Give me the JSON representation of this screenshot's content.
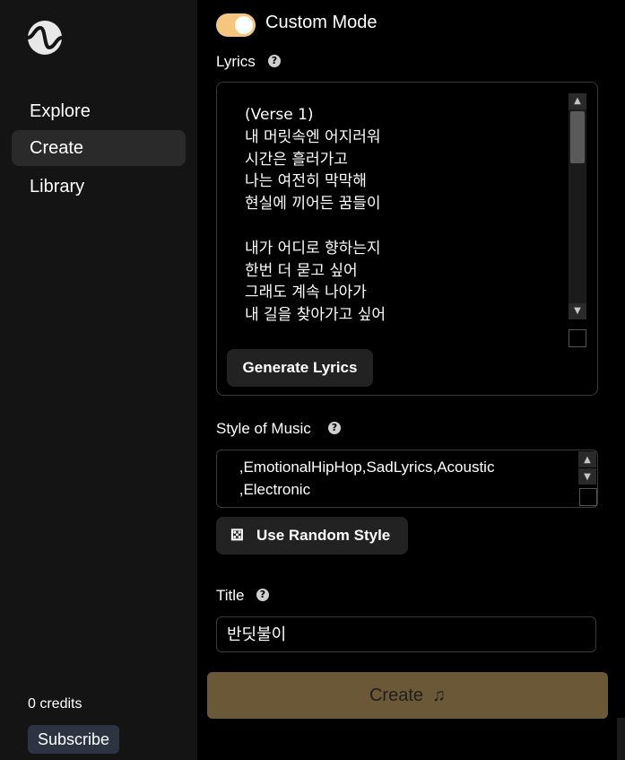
{
  "sidebar": {
    "nav": [
      "Explore",
      "Create",
      "Library"
    ],
    "active": "Create",
    "credits": "0 credits",
    "subscribe": "Subscribe"
  },
  "form": {
    "custom_mode_label": "Custom Mode",
    "custom_mode_on": true,
    "lyrics_label": "Lyrics",
    "lyrics_text": "(Verse 1)\n내 머릿속엔 어지러워\n시간은 흘러가고\n나는 여전히 막막해\n현실에 끼어든 꿈들이\n\n내가 어디로 향하는지\n한번 더 묻고 싶어\n그래도 계속 나아가\n내 길을 찾아가고 싶어",
    "generate_lyrics": "Generate Lyrics",
    "style_label": "Style of Music",
    "style_text": " ,EmotionalHipHop,SadLyrics,Acoustic\n ,Electronic",
    "random_style": "Use Random Style",
    "title_label": "Title",
    "title_value": "반딧불이",
    "create": "Create"
  },
  "colors": {
    "toggle_accent": "#f5c77e",
    "create_button": "#6b5836",
    "subscribe_button": "#2c3441"
  },
  "icons": {
    "logo": "suno-wave-logo",
    "help": "question-circle-icon",
    "dice": "dice-icon",
    "note": "music-note-icon"
  }
}
